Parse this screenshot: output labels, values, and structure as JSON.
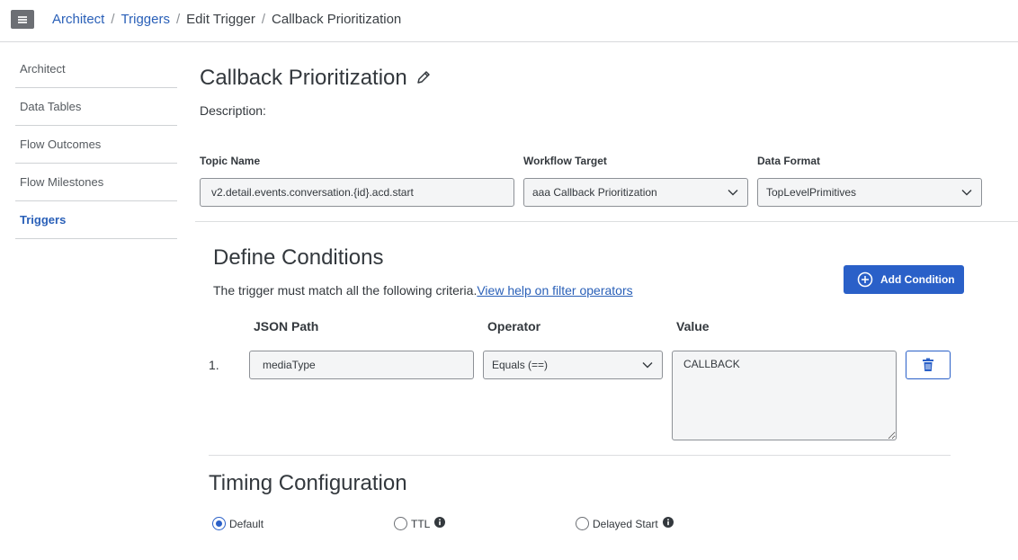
{
  "breadcrumb": {
    "items": [
      "Architect",
      "Triggers",
      "Edit Trigger",
      "Callback Prioritization"
    ],
    "separator": "/"
  },
  "sidebar": {
    "items": [
      {
        "label": "Architect"
      },
      {
        "label": "Data Tables"
      },
      {
        "label": "Flow Outcomes"
      },
      {
        "label": "Flow Milestones"
      },
      {
        "label": "Triggers",
        "active": true
      }
    ]
  },
  "trigger": {
    "title": "Callback Prioritization",
    "description_label": "Description:"
  },
  "fields": {
    "topic_label": "Topic Name",
    "topic_value": "v2.detail.events.conversation.{id}.acd.start",
    "workflow_label": "Workflow Target",
    "workflow_value": "aaa Callback Prioritization",
    "format_label": "Data Format",
    "format_value": "TopLevelPrimitives"
  },
  "conditions": {
    "title": "Define Conditions",
    "criteria_text": "The trigger must match all the following criteria.",
    "help_link": "View help on filter operators",
    "add_button": "Add Condition",
    "columns": [
      "JSON Path",
      "Operator",
      "Value"
    ],
    "rows": [
      {
        "number": "1.",
        "json_path": "mediaType",
        "operator": "Equals (==)",
        "value": "CALLBACK"
      }
    ]
  },
  "timing": {
    "title": "Timing Configuration",
    "options": [
      {
        "label": "Default",
        "selected": true
      },
      {
        "label": "TTL",
        "selected": false,
        "info": true
      },
      {
        "label": "Delayed Start",
        "selected": false,
        "info": true
      }
    ]
  },
  "colors": {
    "accent": "#2a60c8",
    "link": "#2a60b8",
    "text": "#33383d"
  },
  "icons": [
    "menu-icon",
    "pencil-icon",
    "chevron-down-icon",
    "plus-circle-icon",
    "trash-icon",
    "info-icon"
  ]
}
